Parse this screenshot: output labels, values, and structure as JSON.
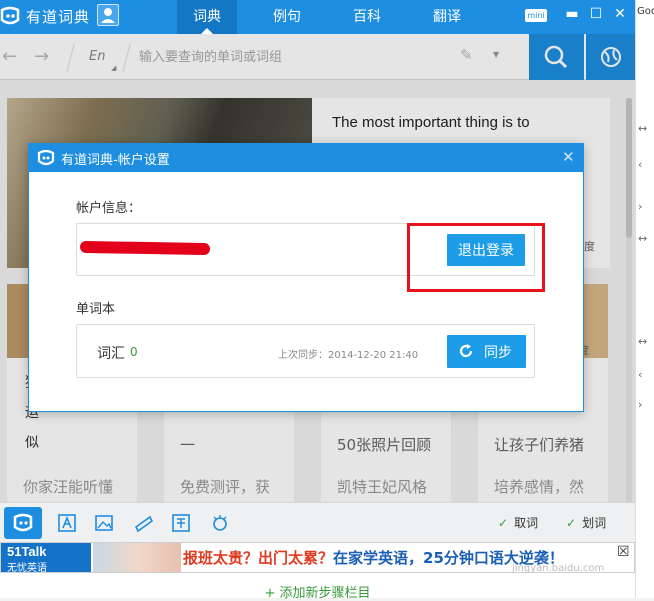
{
  "app": {
    "title": "有道词典",
    "tabs": [
      {
        "label": "词典",
        "active": true
      },
      {
        "label": "例句",
        "active": false
      },
      {
        "label": "百科",
        "active": false
      },
      {
        "label": "翻译",
        "active": false
      }
    ],
    "mini_label": "mini",
    "accent_color": "#1d8ee0"
  },
  "side_strip": {
    "text": "Goo"
  },
  "search": {
    "lang": "En",
    "placeholder": "输入要查询的单词或词组"
  },
  "content": {
    "hero_text": "The most important thing is to",
    "hero_more": "度",
    "card_more": "度",
    "left_card_lines": [
      "狸",
      "运",
      "似"
    ],
    "cards": [
      {
        "line1": "",
        "line2": "你家汪能听懂"
      },
      {
        "line1": "一",
        "line2": "免费测评，获"
      },
      {
        "line1": "50张照片回顾",
        "line2": "凯特王妃风格"
      },
      {
        "line1": "让孩子们养猪",
        "line2": "培养感情，然"
      }
    ]
  },
  "bottombar": {
    "options": [
      {
        "label": "取词",
        "checked": true
      },
      {
        "label": "划词",
        "checked": true
      }
    ]
  },
  "ad": {
    "brand": "51Talk",
    "brand_sub": "无忧英语",
    "slogan_hot": "报班太贵？出门太累？",
    "slogan": "在家学英语，25分钟口语大逆袭！"
  },
  "add_column": "+ 添加新步骤栏目",
  "dialog": {
    "title": "有道词典-帐户设置",
    "account_label": "帐户信息：",
    "logout_label": "退出登录",
    "vocab_section": "单词本",
    "vocab_label": "词汇",
    "vocab_count": "0",
    "sync_time": "上次同步：2014-12-20 21:40",
    "sync_label": "同步"
  },
  "watermark": "jingyan.baidu.com"
}
